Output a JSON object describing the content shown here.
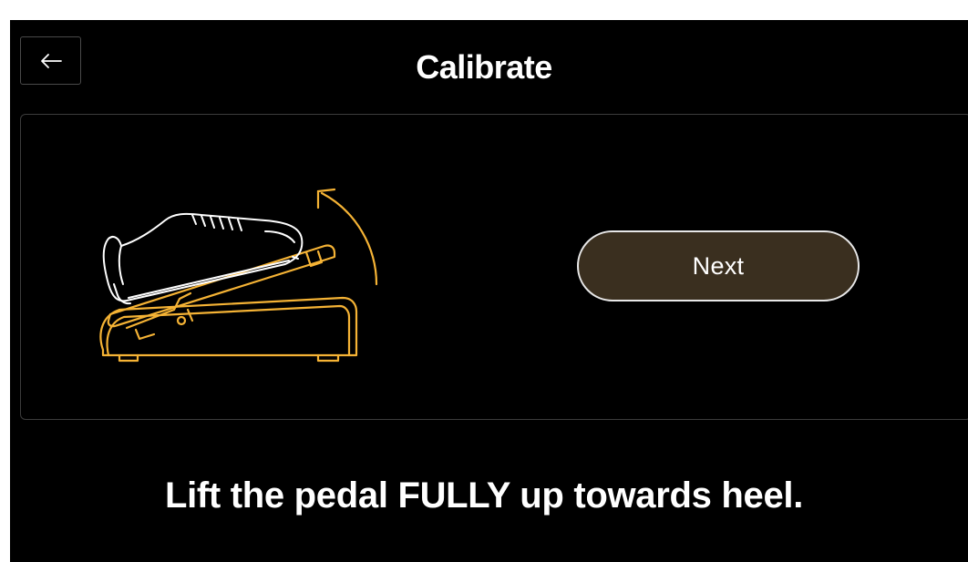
{
  "header": {
    "back_icon": "arrow-left-icon",
    "title": "Calibrate"
  },
  "panel": {
    "illustration": "foot-lifting-expression-pedal",
    "next_label": "Next"
  },
  "instruction": "Lift the pedal FULLY up towards heel.",
  "colors": {
    "background": "#000000",
    "accent": "#f5b335",
    "button_fill": "#3a2f1f",
    "border": "#3c3c3c"
  }
}
